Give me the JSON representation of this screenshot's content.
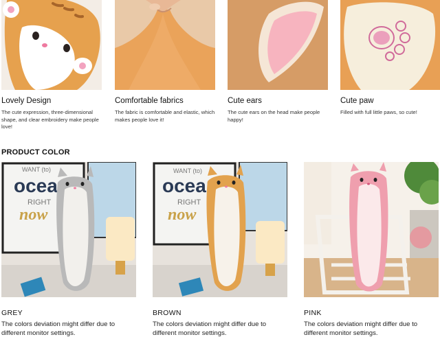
{
  "features": [
    {
      "title": "Lovely Design",
      "description": "The cute expression, three-dimensional shape, and clear embroidery make people love!",
      "image_subject": "orange-cat-face"
    },
    {
      "title": "Comfortable fabrics",
      "description": "The fabric is comfortable and elastic, which makes people love it!",
      "image_subject": "fabric-pinch"
    },
    {
      "title": "Cute ears",
      "description": "The cute ears on the head make people happy!",
      "image_subject": "pink-ear"
    },
    {
      "title": "Cute paw",
      "description": "Filled with full little paws, so cute!",
      "image_subject": "pink-paw"
    }
  ],
  "section_title": "PRODUCT COLOR",
  "colors": [
    {
      "name": "GREY",
      "description": "The colors deviation might differ due to different monitor settings.",
      "plush_color": "#b9b9b9"
    },
    {
      "name": "BROWN",
      "description": "The colors deviation might differ due to different monitor settings.",
      "plush_color": "#e2a24e"
    },
    {
      "name": "PINK",
      "description": "The colors deviation might differ due to different monitor settings.",
      "plush_color": "#ef9fae"
    }
  ],
  "poster_text": {
    "line1": "WANT (to)",
    "line2": "ocean",
    "line3": "RIGHT",
    "line4": "now"
  }
}
